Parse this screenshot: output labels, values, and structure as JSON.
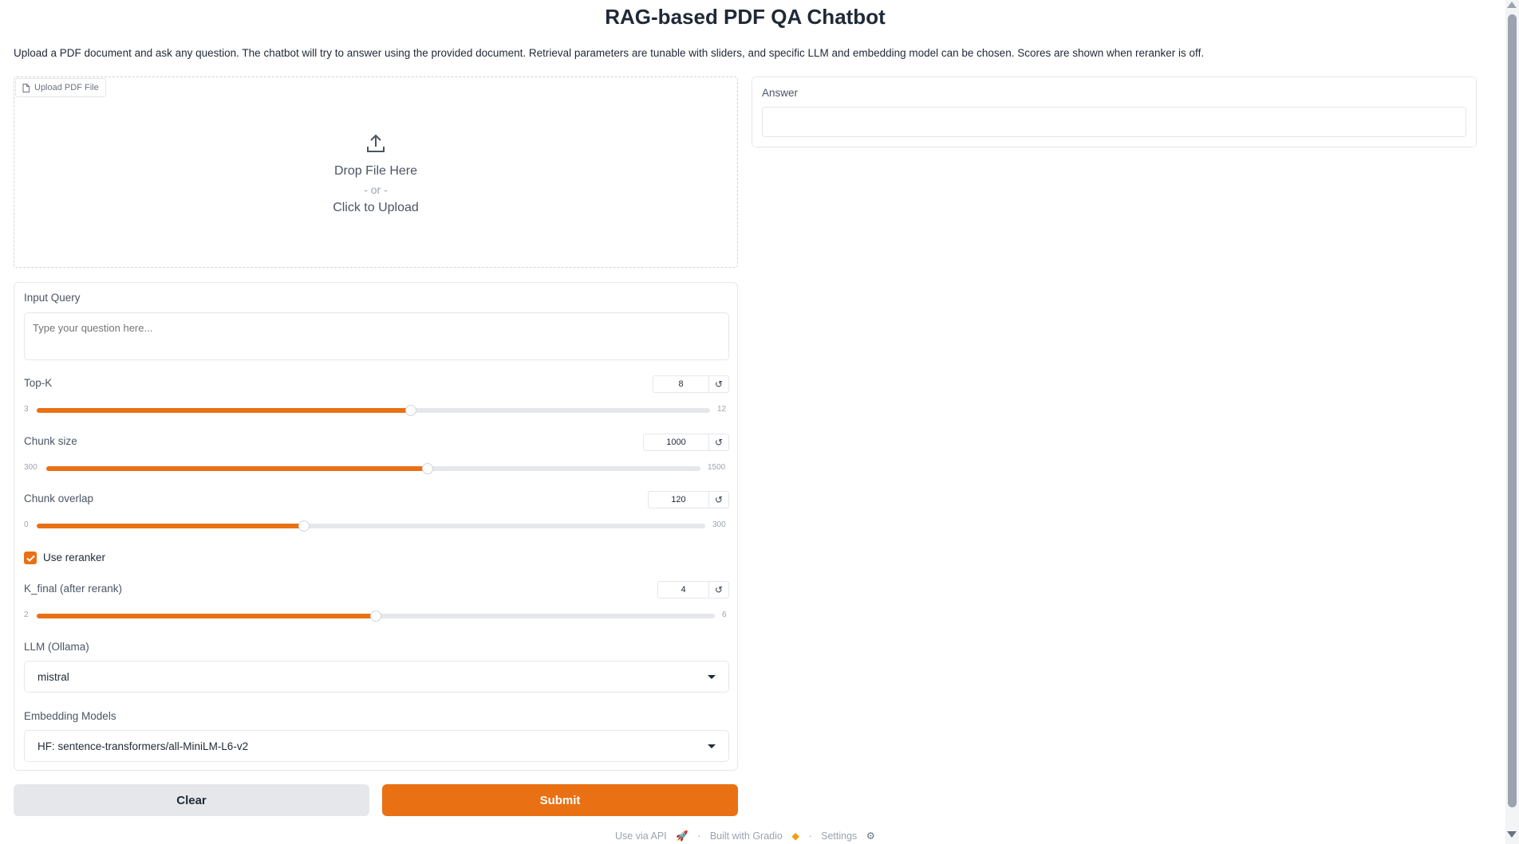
{
  "header": {
    "title": "RAG-based PDF QA Chatbot",
    "description": "Upload a PDF document and ask any question. The chatbot will try to answer using the provided document. Retrieval parameters are tunable with sliders, and specific LLM and embedding model can be chosen. Scores are shown when reranker is off."
  },
  "upload": {
    "tag_label": "Upload PDF File",
    "drop_text": "Drop File Here",
    "or_text": "- or -",
    "click_text": "Click to Upload"
  },
  "query": {
    "label": "Input Query",
    "placeholder": "Type your question here..."
  },
  "sliders": [
    {
      "label": "Top-K",
      "value": "8",
      "min": "3",
      "max": "12",
      "fraction": 0.556
    },
    {
      "label": "Chunk size",
      "value": "1000",
      "min": "300",
      "max": "1500",
      "fraction": 0.583
    },
    {
      "label": "Chunk overlap",
      "value": "120",
      "min": "0",
      "max": "300",
      "fraction": 0.4
    },
    {
      "label": "K_final (after rerank)",
      "value": "4",
      "min": "2",
      "max": "6",
      "fraction": 0.5
    }
  ],
  "reranker": {
    "label": "Use reranker",
    "checked": true
  },
  "llm": {
    "label": "LLM (Ollama)",
    "value": "mistral"
  },
  "embedding": {
    "label": "Embedding Models",
    "value": "HF: sentence-transformers/all-MiniLM-L6-v2"
  },
  "buttons": {
    "clear": "Clear",
    "submit": "Submit"
  },
  "answer": {
    "label": "Answer",
    "value": ""
  },
  "footer": {
    "api": "Use via API",
    "separator": "·",
    "built": "Built with Gradio",
    "settings": "Settings"
  },
  "colors": {
    "accent": "#ea7014",
    "border": "#e5e7eb",
    "muted": "#9ca3af"
  }
}
